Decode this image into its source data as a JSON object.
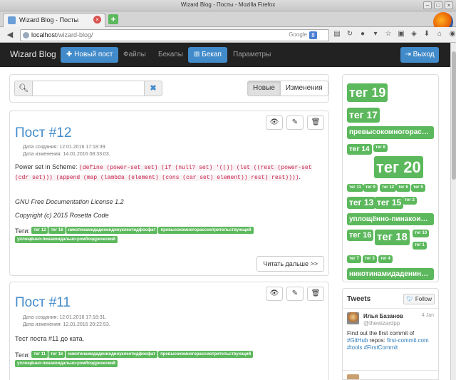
{
  "window": {
    "title": "Wizard Blog - Посты - Mozilla Firefox"
  },
  "browser": {
    "tab_title": "Wizard Blog - Посты",
    "url_host": "localhost",
    "url_path": "/wizard-blog/",
    "search_engine": "Google"
  },
  "appnav": {
    "brand": "Wizard Blog",
    "new_post": "Новый пост",
    "files": "Файлы",
    "backups": "Бекапы",
    "backup": "Бекап",
    "settings": "Параметры",
    "logout": "Выход"
  },
  "search": {
    "placeholder": "",
    "sort_new": "Новые",
    "sort_changes": "Изменения"
  },
  "posts": [
    {
      "title": "Пост #12",
      "created": "Дата создания: 12.01.2016 17:18:39.",
      "modified": "Дата изменения: 14.01.2016 08:33:03.",
      "text_prefix": "Power set in Scheme: ",
      "code": "(define (power-set set) (if (null? set) '(()) (let ((rest (power-set (cdr set))) (append (map (lambda (element) (cons (car set) element)) rest) rest))))",
      "code_suffix": ".",
      "license": "GNU Free Documentation License 1.2",
      "copyright": "Copyright (c) 2015 Rosetta Code",
      "tags_label": "Теги:",
      "tags": [
        "тег 12",
        "тег 16",
        "никотинамидадениндинуклеотидфосфат",
        "превысокомногорассмотрительствующий",
        "уплощённо-пинакоидально-ромбоэдрический"
      ],
      "readmore": "Читать дальше >>"
    },
    {
      "title": "Пост #11",
      "created": "Дата создания: 12.01.2016 17:18:31.",
      "modified": "Дата изменения: 12.01.2016 20:22:53.",
      "text": "Тест поста #11 до ката.",
      "tags_label": "Теги:",
      "tags": [
        "тег 11",
        "тег 16",
        "никотинамидадениндинуклеотидфосфат",
        "превысокомногорассмотрительствующий",
        "уплощённо-пинакоидально-ромбоэдрический"
      ]
    }
  ],
  "tagcloud": [
    {
      "label": "тег 19"
    },
    {
      "label": "тег 17"
    },
    {
      "label": "превысокомногорассмотрительствующий"
    },
    {
      "label": "тег 14"
    },
    {
      "label": "тег 8"
    },
    {
      "label": "тег 20"
    },
    {
      "label": "тег 11"
    },
    {
      "label": "тег 9"
    },
    {
      "label": "тег 12"
    },
    {
      "label": "тег 6"
    },
    {
      "label": "тег 5"
    },
    {
      "label": "тег 13"
    },
    {
      "label": "тег 15"
    },
    {
      "label": "тег 2"
    },
    {
      "label": "уплощённо-пинакоидально-ромбоэдрический"
    },
    {
      "label": "тег 16"
    },
    {
      "label": "тег 18"
    },
    {
      "label": "тег 10"
    },
    {
      "label": "тег 1"
    },
    {
      "label": "тег 7"
    },
    {
      "label": "тег 3"
    },
    {
      "label": "тег 4"
    },
    {
      "label": "никотинамидадениндинуклеотидфосфат"
    }
  ],
  "tweets": {
    "title": "Tweets",
    "follow": "Follow",
    "items": [
      {
        "name": "Илья Базанов",
        "handle": "@thewizardpp",
        "date": "4 Jan",
        "text_1": "Find out the first commit of ",
        "link_1": "#GitHub",
        "text_2": " repos: ",
        "link_2": "first-commit.com",
        "text_3": " ",
        "link_3": "#tools",
        "text_4": " ",
        "link_4": "#FirstCommit"
      }
    ]
  },
  "colors": {
    "primary": "#428bca",
    "tag_green": "#5cb85c",
    "navbar": "#222222",
    "code": "#c7254e"
  }
}
